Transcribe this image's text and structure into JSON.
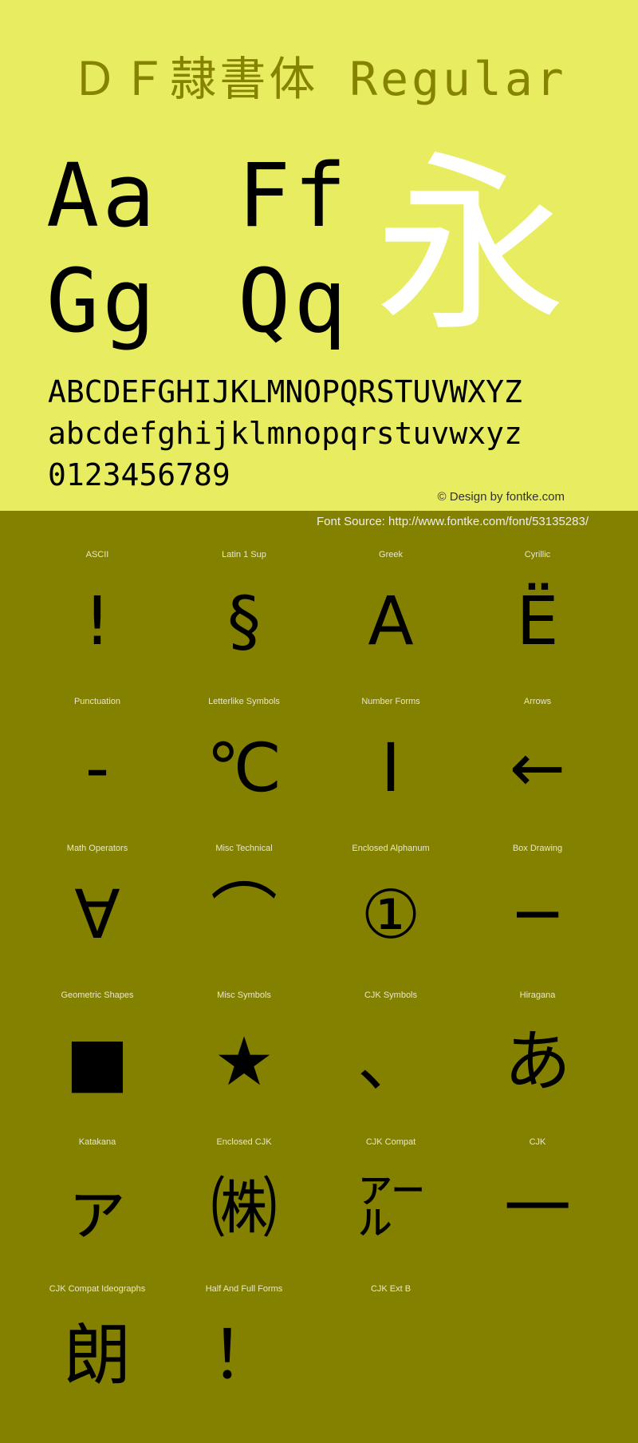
{
  "header": {
    "title": "ＤＦ隷書体 Regular"
  },
  "specimen": {
    "pairs": [
      "Aa",
      "Ff",
      "Gg",
      "Qq"
    ],
    "showcase_char": "永",
    "uppercase": "ABCDEFGHIJKLMNOPQRSTUVWXYZ",
    "lowercase": "abcdefghijklmnopqrstuvwxyz",
    "digits": "0123456789"
  },
  "credit": "© Design by fontke.com",
  "source": "Font Source: http://www.fontke.com/font/53135283/",
  "colors": {
    "top_bg": "#E8EC60",
    "bottom_bg": "#848000",
    "title": "#858300",
    "showcase": "#FFFFFF"
  },
  "blocks": [
    {
      "label": "ASCII",
      "glyph": "!"
    },
    {
      "label": "Latin 1 Sup",
      "glyph": "§"
    },
    {
      "label": "Greek",
      "glyph": "Α"
    },
    {
      "label": "Cyrillic",
      "glyph": "Ё"
    },
    {
      "label": "Punctuation",
      "glyph": "‐"
    },
    {
      "label": "Letterlike Symbols",
      "glyph": "℃"
    },
    {
      "label": "Number Forms",
      "glyph": "Ⅰ"
    },
    {
      "label": "Arrows",
      "glyph": "←"
    },
    {
      "label": "Math Operators",
      "glyph": "∀"
    },
    {
      "label": "Misc Technical",
      "glyph": "⌒"
    },
    {
      "label": "Enclosed Alphanum",
      "glyph": "①"
    },
    {
      "label": "Box Drawing",
      "glyph": "─"
    },
    {
      "label": "Geometric Shapes",
      "glyph": "■"
    },
    {
      "label": "Misc Symbols",
      "glyph": "★"
    },
    {
      "label": "CJK Symbols",
      "glyph": "、"
    },
    {
      "label": "Hiragana",
      "glyph": "あ"
    },
    {
      "label": "Katakana",
      "glyph": "ァ"
    },
    {
      "label": "Enclosed CJK",
      "glyph": "㈱"
    },
    {
      "label": "CJK Compat",
      "glyph": "㌃"
    },
    {
      "label": "CJK",
      "glyph": "一"
    },
    {
      "label": "CJK Compat Ideographs",
      "glyph": "朗"
    },
    {
      "label": "Half And Full Forms",
      "glyph": "！"
    },
    {
      "label": "CJK Ext B",
      "glyph": ""
    }
  ]
}
